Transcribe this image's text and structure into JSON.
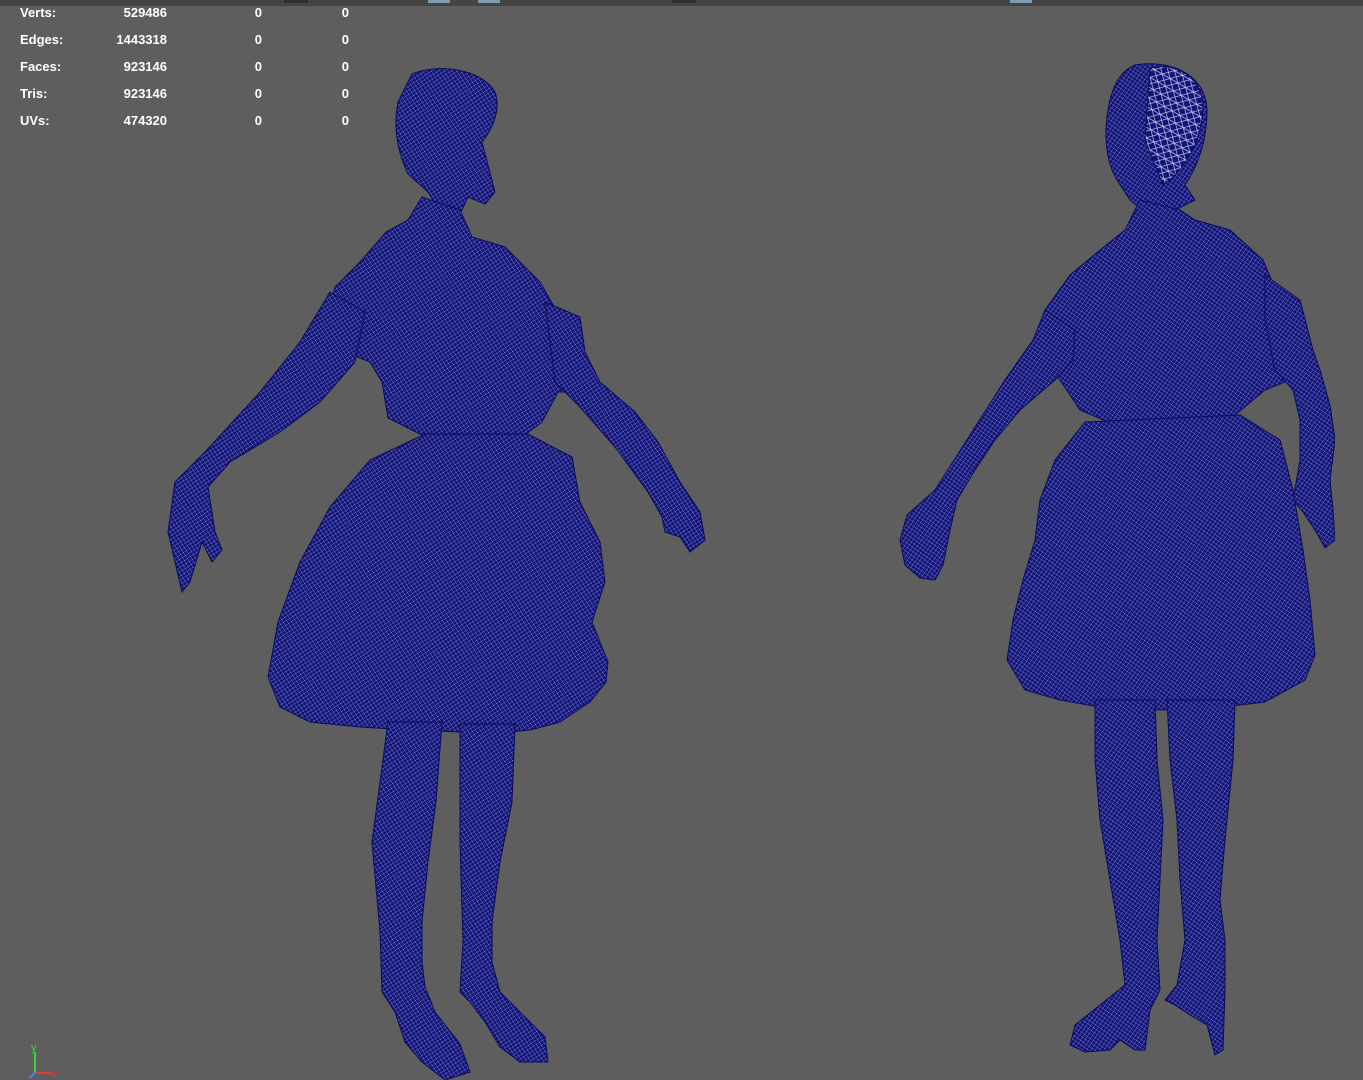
{
  "viewport": {
    "background": "#5e5e5e",
    "mesh_color": "#10137a"
  },
  "stats": [
    {
      "label": "Verts:",
      "v1": "529486",
      "v2": "0",
      "v3": "0"
    },
    {
      "label": "Edges:",
      "v1": "1443318",
      "v2": "0",
      "v3": "0"
    },
    {
      "label": "Faces:",
      "v1": "923146",
      "v2": "0",
      "v3": "0"
    },
    {
      "label": "Tris:",
      "v1": "923146",
      "v2": "0",
      "v3": "0"
    },
    {
      "label": "UVs:",
      "v1": "474320",
      "v2": "0",
      "v3": "0"
    }
  ],
  "axis": {
    "y": "y",
    "x": "x"
  }
}
